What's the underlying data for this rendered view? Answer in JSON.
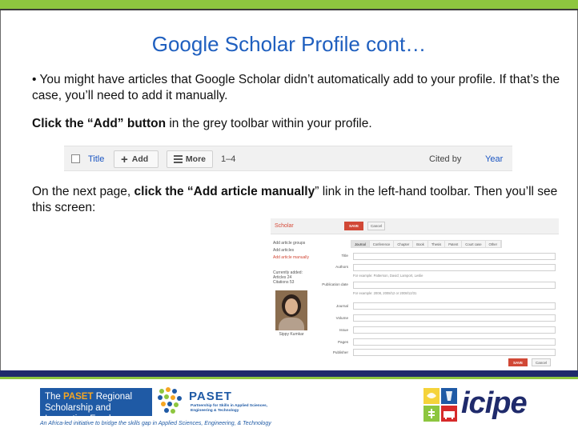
{
  "slide": {
    "title": "Google Scholar Profile cont…",
    "bullet_text": "• You might have articles that Google Scholar didn’t automatically add to your profile. If that’s the case, you’ll need to add it manually.",
    "click_add_bold": "Click the “Add” button",
    "click_add_rest": " in the grey toolbar within your profile.",
    "next_page_pre": "On the next page, ",
    "next_page_bold": "click the “Add article manually",
    "next_page_post": "” link in the left-hand toolbar. Then you’ll see this screen:"
  },
  "toolbar": {
    "title_link": "Title",
    "add_label": "Add",
    "more_label": "More",
    "range": "1–4",
    "cited_by": "Cited by",
    "year": "Year"
  },
  "screenshot": {
    "brand": "Scholar",
    "save": "SAVE",
    "cancel": "Cancel",
    "side_items": [
      "Add article groups",
      "Add articles",
      "Add article manually"
    ],
    "currently_added": "Currently added:",
    "articles": "Articles  24",
    "citations": "Citations  53",
    "person_name": "Sippy Kumkar",
    "tabs": [
      "Journal",
      "Conference",
      "Chapter",
      "Book",
      "Thesis",
      "Patent",
      "Court case",
      "Other"
    ],
    "fields": {
      "title": "Title",
      "authors": "Authors",
      "authors_hint": "For example: Patterson, David; Lamport, Leslie",
      "publication_date": "Publication date",
      "date_hint": "For example: 2008, 2008/12 or 2008/12/31",
      "journal": "Journal",
      "volume": "Volume",
      "issue": "Issue",
      "pages": "Pages",
      "publisher": "Publisher"
    }
  },
  "footer": {
    "paset_box_pre": "The ",
    "paset_box_hl": "PASET",
    "paset_box_post": " Regional Scholarship and Innovation Fund",
    "paset_logo": "PASET",
    "paset_sub": "Partnership for Skills in Applied Sciences, Engineering & Technology",
    "tagline": "An Africa-led initiative to bridge the skills gap in Applied Sciences, Engineering, & Technology",
    "icipe": "icipe"
  },
  "colors": {
    "title_blue": "#1f5fbf",
    "top_green": "#8dc63f",
    "footer_navy": "#1f2a6b",
    "save_red": "#d14836"
  }
}
